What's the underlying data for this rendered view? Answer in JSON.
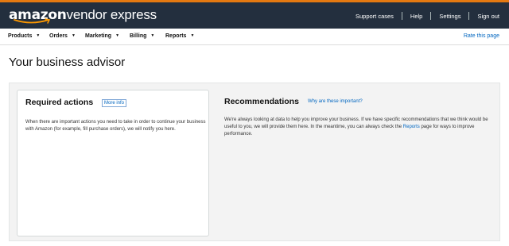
{
  "header": {
    "logo_brand": "amazon",
    "logo_rest": "vendor express",
    "links": [
      "Support cases",
      "Help",
      "Settings",
      "Sign out"
    ]
  },
  "nav": {
    "items": [
      "Products",
      "Orders",
      "Marketing",
      "Billing",
      "Reports"
    ],
    "rate_link": "Rate this page"
  },
  "page": {
    "title": "Your business advisor"
  },
  "required_actions": {
    "title": "Required actions",
    "more_info": "More info",
    "text": "When there are important actions you need to take in order to continue your business with Amazon (for example, fill purchase orders), we will notify you here."
  },
  "recommendations": {
    "title": "Recommendations",
    "why_link": "Why are these important?",
    "text_before": "We're always looking at data to help you improve your business. If we have specific recommendations that we think would be useful to you, we will provide them here. In the meantime, you can always check the ",
    "reports_link": "Reports",
    "text_after": " page for ways to improve performance."
  },
  "colors": {
    "topbar": "#232f3e",
    "accent": "#e47911",
    "link": "#0066c0",
    "panel": "#f3f3f3"
  }
}
